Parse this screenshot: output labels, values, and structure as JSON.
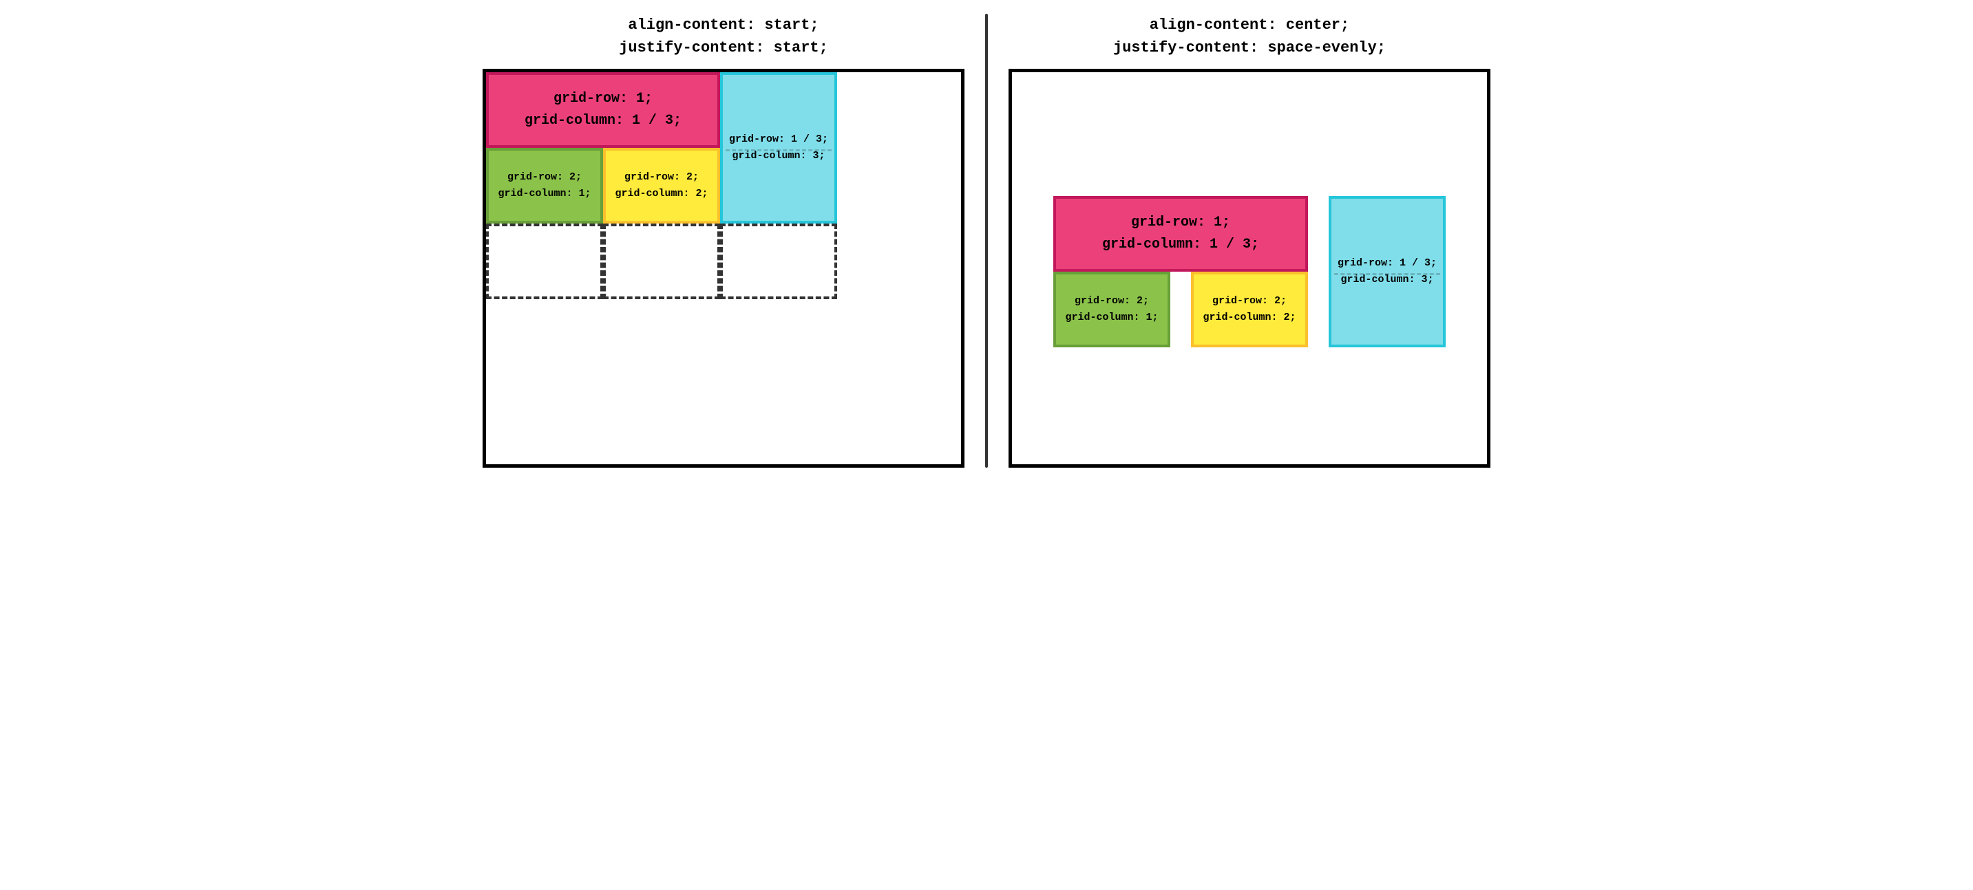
{
  "headings": {
    "left": {
      "line1": "align-content: start;",
      "line2": "justify-content: start;"
    },
    "right": {
      "line1": "align-content: center;",
      "line2": "justify-content: space-evenly;"
    }
  },
  "items": {
    "pink": {
      "line1": "grid-row: 1;",
      "line2": "grid-column: 1 / 3;"
    },
    "green": {
      "line1": "grid-row: 2;",
      "line2": "grid-column: 1;"
    },
    "yellow": {
      "line1": "grid-row: 2;",
      "line2": "grid-column: 2;"
    },
    "cyan": {
      "line1": "grid-row: 1 / 3;",
      "line2": "grid-column: 3;"
    }
  },
  "colors": {
    "pink": "#ec407a",
    "green": "#8bc34a",
    "yellow": "#ffeb3b",
    "cyan": "#80deea"
  },
  "left_grid": {
    "rows": 3,
    "cols": 3,
    "align_content": "start",
    "justify_content": "start"
  },
  "right_grid": {
    "rows": 2,
    "cols": 3,
    "align_content": "center",
    "justify_content": "space-evenly"
  }
}
